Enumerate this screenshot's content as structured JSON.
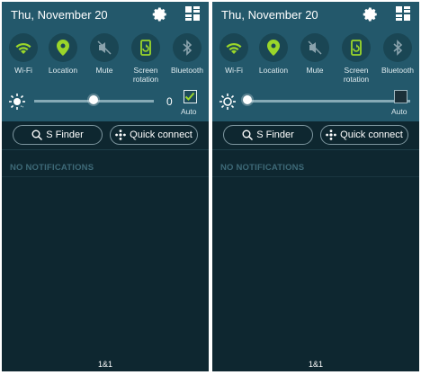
{
  "panels": [
    {
      "date": "Thu, November 20",
      "quick_settings": [
        {
          "label": "Wi-Fi",
          "icon": "wifi-icon",
          "active": true
        },
        {
          "label": "Location",
          "icon": "location-icon",
          "active": true
        },
        {
          "label": "Mute",
          "icon": "mute-icon",
          "active": false
        },
        {
          "label": "Screen\nrotation",
          "icon": "screen-rotation-icon",
          "active": true
        },
        {
          "label": "Bluetooth",
          "icon": "bluetooth-icon",
          "active": false
        }
      ],
      "brightness": {
        "value_label": "0",
        "level_fraction": 0.47,
        "auto_label": "Auto",
        "auto_checked": true
      },
      "buttons": {
        "s_finder": "S Finder",
        "quick_connect": "Quick connect"
      },
      "no_notifications": "NO NOTIFICATIONS",
      "carrier": "1&1"
    },
    {
      "date": "Thu, November 20",
      "quick_settings": [
        {
          "label": "Wi-Fi",
          "icon": "wifi-icon",
          "active": true
        },
        {
          "label": "Location",
          "icon": "location-icon",
          "active": true
        },
        {
          "label": "Mute",
          "icon": "mute-icon",
          "active": false
        },
        {
          "label": "Screen\nrotation",
          "icon": "screen-rotation-icon",
          "active": true
        },
        {
          "label": "Bluetooth",
          "icon": "bluetooth-icon",
          "active": false
        }
      ],
      "brightness": {
        "value_label": "",
        "level_fraction": 0.0,
        "auto_label": "Auto",
        "auto_checked": false
      },
      "buttons": {
        "s_finder": "S Finder",
        "quick_connect": "Quick connect"
      },
      "no_notifications": "NO NOTIFICATIONS",
      "carrier": "1&1"
    }
  ],
  "colors": {
    "active_green": "#9ad62a",
    "inactive_gray": "#8aa3ad",
    "panel_top": "#23586b",
    "panel_body": "#0e2730"
  }
}
